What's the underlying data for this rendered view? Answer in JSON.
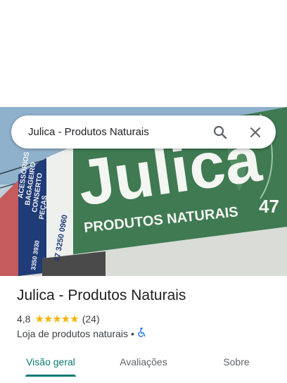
{
  "search": {
    "value": "Julica - Produtos Naturais",
    "search_icon": "search-icon",
    "close_icon": "close-icon"
  },
  "photo": {
    "storefront_sign_main": "Julica",
    "storefront_sign_sub": "PRODUTOS NATURAIS",
    "phone_fragment": "47",
    "side_sign_lines": [
      "ACESSÓRIOS",
      "BAGAGEIRO",
      "CONSERTO",
      "PEÇAS"
    ],
    "side_phone_1": "47 3250 0960",
    "side_phone_2": "3350 3930"
  },
  "place": {
    "name": "Julica - Produtos Naturais",
    "rating": "4,8",
    "stars": "★★★★★",
    "review_count": "(24)",
    "category": "Loja de produtos naturais",
    "separator": "•",
    "accessibility_icon": "wheelchair-icon"
  },
  "tabs": [
    {
      "label": "Visão geral",
      "active": true
    },
    {
      "label": "Avaliações",
      "active": false
    },
    {
      "label": "Sobre",
      "active": false
    }
  ],
  "colors": {
    "accent": "#0b7a75",
    "star": "#f4b400",
    "accessibility": "#1a73e8",
    "sign_green": "#3f7a52"
  }
}
